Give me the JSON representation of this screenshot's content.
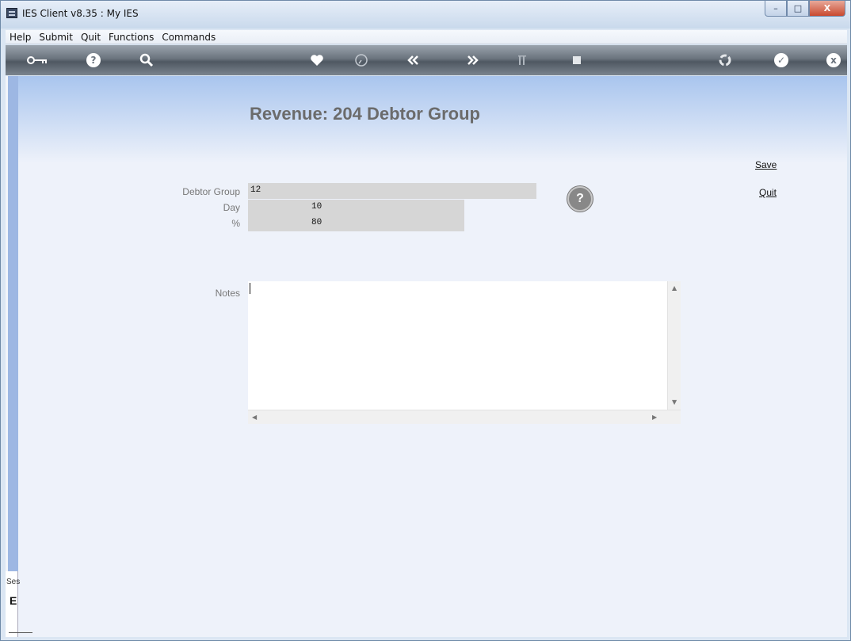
{
  "window": {
    "title": "IES Client v8.35 : My IES",
    "controls": {
      "minimize": "–",
      "maximize": "□",
      "close": "X"
    }
  },
  "menu": {
    "items": [
      "Help",
      "Submit",
      "Quit",
      "Functions",
      "Commands"
    ]
  },
  "toolbar": {
    "icons": [
      "key-icon",
      "help-icon",
      "search-icon",
      "heart-icon",
      "clock-icon",
      "rewind-icon",
      "forward-icon",
      "columns-icon",
      "stop-icon",
      "recycle-icon",
      "check-icon",
      "close-icon"
    ],
    "help_glyph": "?",
    "check_glyph": "✓",
    "close_glyph": "x"
  },
  "form": {
    "title": "Revenue: 204 Debtor Group",
    "debtor_group_label": "Debtor Group",
    "debtor_group_value": "12",
    "day_label": "Day",
    "day_value": "10",
    "percent_label": "%",
    "percent_value": "80",
    "notes_label": "Notes",
    "notes_value": "",
    "help_glyph": "?"
  },
  "actions": {
    "save_label": "Save",
    "quit_label": "Quit"
  },
  "session": {
    "label": "Ses",
    "icon_glyph": "E"
  },
  "colors": {
    "toolbar_bg": "#6a737d",
    "band": "#a9c5ee",
    "content_bg": "#eef2fa",
    "field_bg": "#d6d6d6",
    "title_text": "#6b6b6b"
  }
}
